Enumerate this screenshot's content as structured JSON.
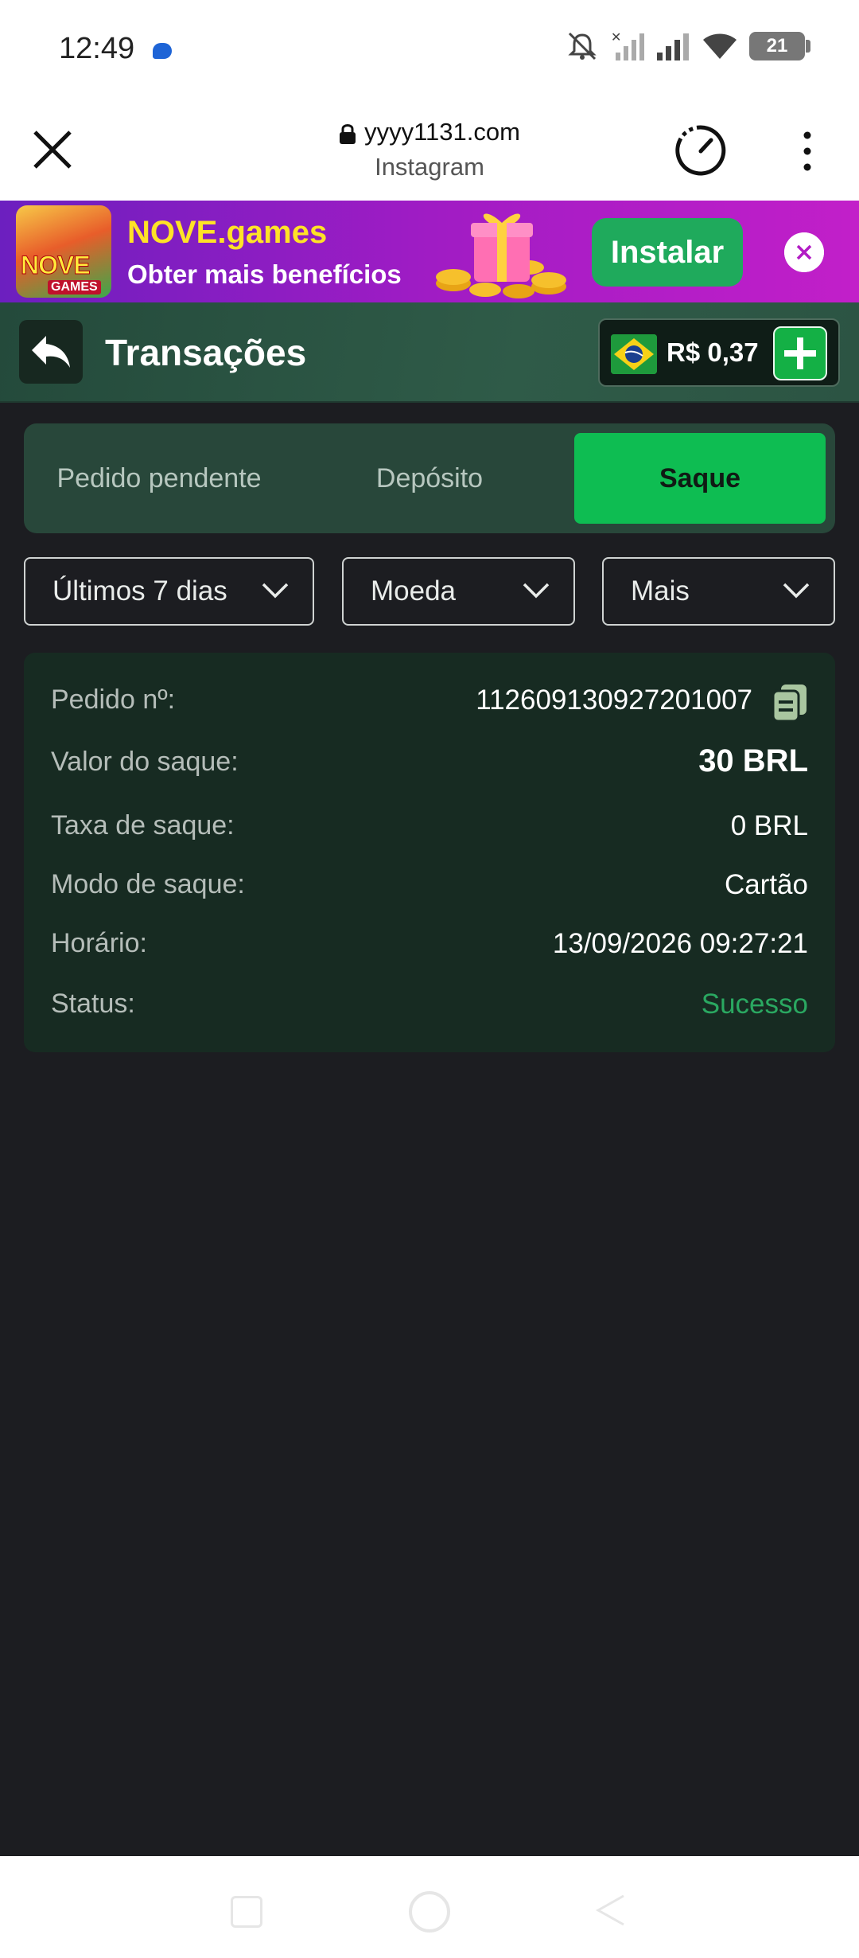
{
  "status_bar": {
    "time": "12:49",
    "battery": "21",
    "icons": [
      "messenger-icon",
      "mute-icon",
      "no-signal-icon",
      "signal-icon",
      "wifi-icon",
      "battery-icon"
    ]
  },
  "browser": {
    "url": "yyyy1131.com",
    "source": "Instagram"
  },
  "banner": {
    "title": "NOVE.games",
    "subtitle": "Obter mais benefícios",
    "logo_text": "NOVE",
    "logo_sub": "GAMES",
    "install_label": "Instalar"
  },
  "header": {
    "title": "Transações",
    "balance": "R$ 0,37"
  },
  "tabs": [
    {
      "label": "Pedido pendente",
      "active": false
    },
    {
      "label": "Depósito",
      "active": false
    },
    {
      "label": "Saque",
      "active": true
    }
  ],
  "filters": {
    "period": "Últimos 7 dias",
    "currency": "Moeda",
    "more": "Mais"
  },
  "transaction": {
    "order_label": "Pedido nº:",
    "order_value": "112609130927201007",
    "amount_label": "Valor do saque:",
    "amount_value": "30 BRL",
    "fee_label": "Taxa de saque:",
    "fee_value": "0 BRL",
    "mode_label": "Modo de saque:",
    "mode_value": "Cartão",
    "time_label": "Horário:",
    "time_value": "13/09/2026 09:27:21",
    "status_label": "Status:",
    "status_value": "Sucesso"
  },
  "colors": {
    "accent_green": "#0ebd52",
    "success": "#2aa861",
    "banner_title": "#ffe227",
    "background": "#1c1d21"
  }
}
